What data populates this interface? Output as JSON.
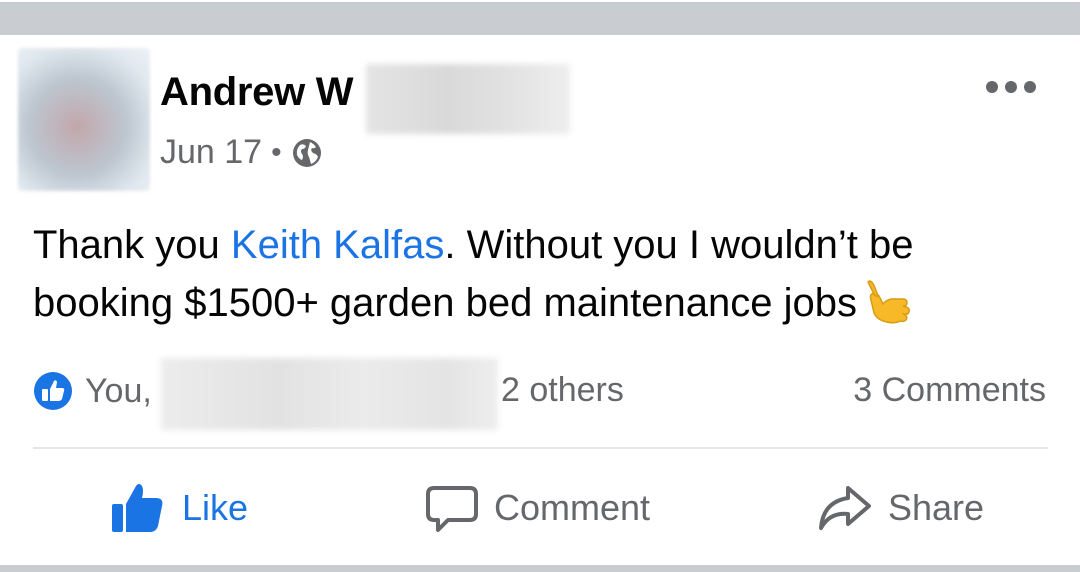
{
  "post": {
    "author": "Andrew W",
    "date": "Jun 17",
    "separator": "•",
    "privacy_icon": "globe-icon",
    "more_icon": "ellipsis-icon",
    "text_before": "Thank you ",
    "mention": "Keith Kalfas",
    "text_after": ". Without you I wouldn’t be booking $1500+ garden bed maintenance jobs",
    "emoji": "call-me-hand-emoji"
  },
  "reactions": {
    "icon": "like-badge-icon",
    "you": "You,",
    "others": "2 others",
    "comments": "3 Comments"
  },
  "actions": {
    "like": "Like",
    "comment": "Comment",
    "share": "Share"
  },
  "colors": {
    "accent": "#1b74e4",
    "secondary_text": "#65676b",
    "band": "#c9ccd1",
    "emoji": "#f7b928"
  }
}
